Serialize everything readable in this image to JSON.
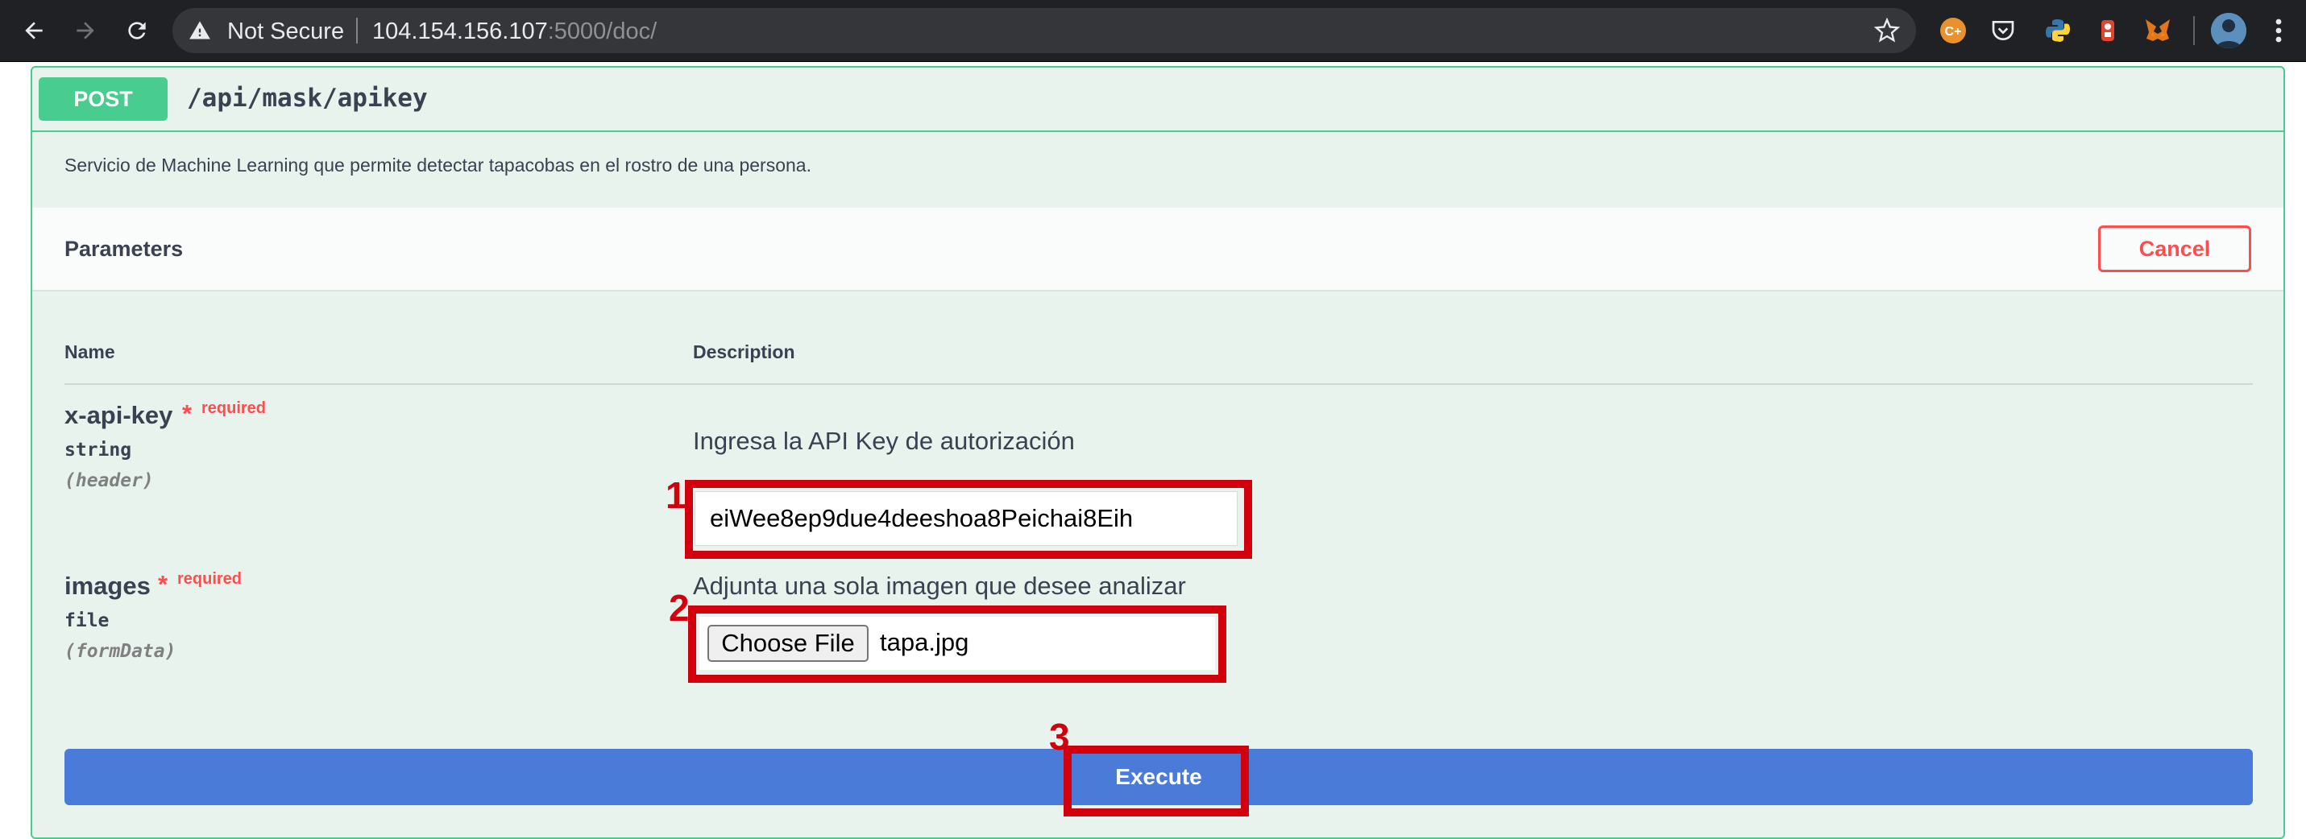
{
  "browser": {
    "security_text": "Not Secure",
    "url_host": "104.154.156.107",
    "url_path": ":5000/doc/",
    "icons": [
      "back-icon",
      "forward-icon",
      "reload-icon",
      "warning-icon",
      "bookmark-star-icon",
      "pocket-icon",
      "python-icon",
      "extension-icon",
      "metamask-fox-icon",
      "menu-dots-icon"
    ]
  },
  "operation": {
    "method": "POST",
    "path": "/api/mask/apikey",
    "description": "Servicio de Machine Learning que permite detectar tapacobas en el rostro de una persona."
  },
  "parameters": {
    "title": "Parameters",
    "cancel_label": "Cancel",
    "col_name": "Name",
    "col_description": "Description",
    "items": [
      {
        "name": "x-api-key",
        "star": "*",
        "required": "required",
        "type": "string",
        "in": "(header)",
        "description": "Ingresa la API Key de autorización",
        "value": "eiWee8ep9due4deeshoa8Peichai8Eih"
      },
      {
        "name": "images",
        "star": "*",
        "required": "required",
        "type": "file",
        "in": "(formData)",
        "description": "Adjunta una sola imagen que desee analizar",
        "button_label": "Choose File",
        "file_name": "tapa.jpg"
      }
    ]
  },
  "execute_label": "Execute",
  "annotations": [
    "1",
    "2",
    "3"
  ],
  "colors": {
    "post_green": "#49cc90",
    "execute_blue": "#4a7bd8",
    "cancel_red": "#ff4d4d",
    "annotation_red": "#d2000d"
  }
}
